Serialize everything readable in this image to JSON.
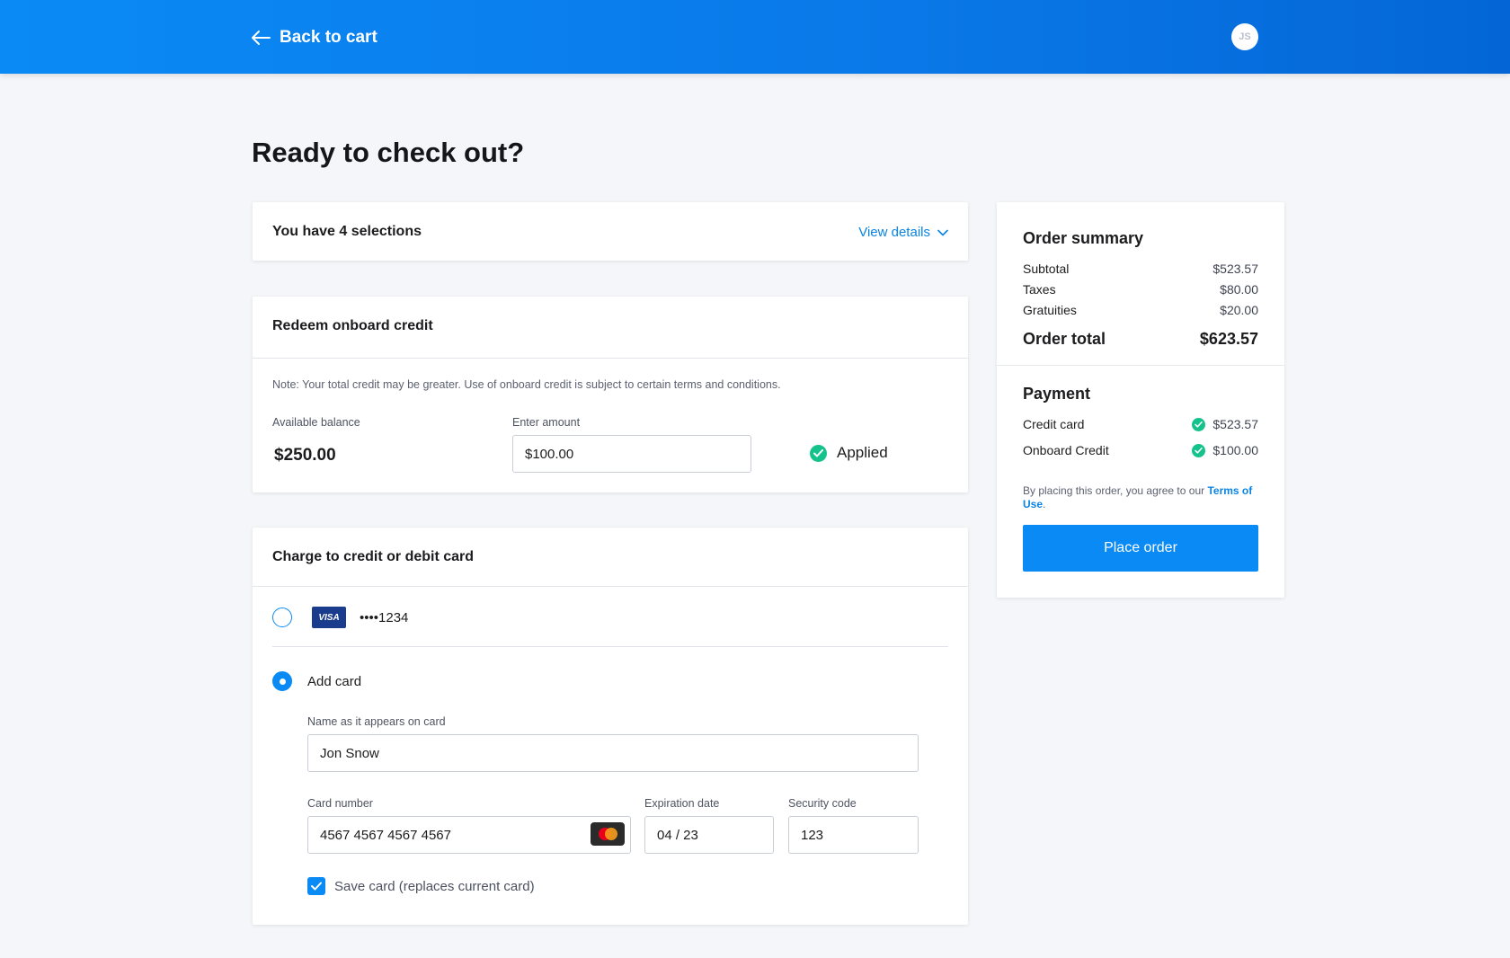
{
  "header": {
    "back_label": "Back to cart",
    "avatar_initials": "JS"
  },
  "page": {
    "title": "Ready to check out?"
  },
  "selections": {
    "text": "You have 4 selections",
    "view_details_label": "View details"
  },
  "redeem": {
    "title": "Redeem onboard credit",
    "note": "Note: Your total credit may be greater. Use of onboard credit is subject to certain terms and conditions.",
    "balance_label": "Available balance",
    "balance_value": "$250.00",
    "amount_label": "Enter amount",
    "amount_value": "$100.00",
    "status": "Applied"
  },
  "charge": {
    "title": "Charge to credit or debit card",
    "saved_card": {
      "brand": "VISA",
      "masked_number": "••••1234"
    },
    "add_card_label": "Add card",
    "name_label": "Name as it appears on card",
    "name_value": "Jon Snow",
    "card_number_label": "Card number",
    "card_number_value": "4567 4567 4567 4567",
    "expiration_label": "Expiration date",
    "expiration_value": "04 / 23",
    "security_label": "Security code",
    "security_value": "123",
    "save_card_label": "Save card (replaces current card)",
    "save_card_checked": true
  },
  "summary": {
    "title": "Order summary",
    "rows": [
      {
        "label": "Subtotal",
        "value": "$523.57"
      },
      {
        "label": "Taxes",
        "value": "$80.00"
      },
      {
        "label": "Gratuities",
        "value": "$20.00"
      }
    ],
    "total_label": "Order total",
    "total_value": "$623.57",
    "payment_title": "Payment",
    "payments": [
      {
        "label": "Credit card",
        "value": "$523.57"
      },
      {
        "label": "Onboard Credit",
        "value": "$100.00"
      }
    ],
    "terms_prefix": "By placing this order, you agree to our ",
    "terms_link": "Terms of Use",
    "terms_suffix": ".",
    "place_order_label": "Place order"
  },
  "colors": {
    "accent": "#0a8af5",
    "success": "#15c28b",
    "link": "#0a84e3"
  }
}
